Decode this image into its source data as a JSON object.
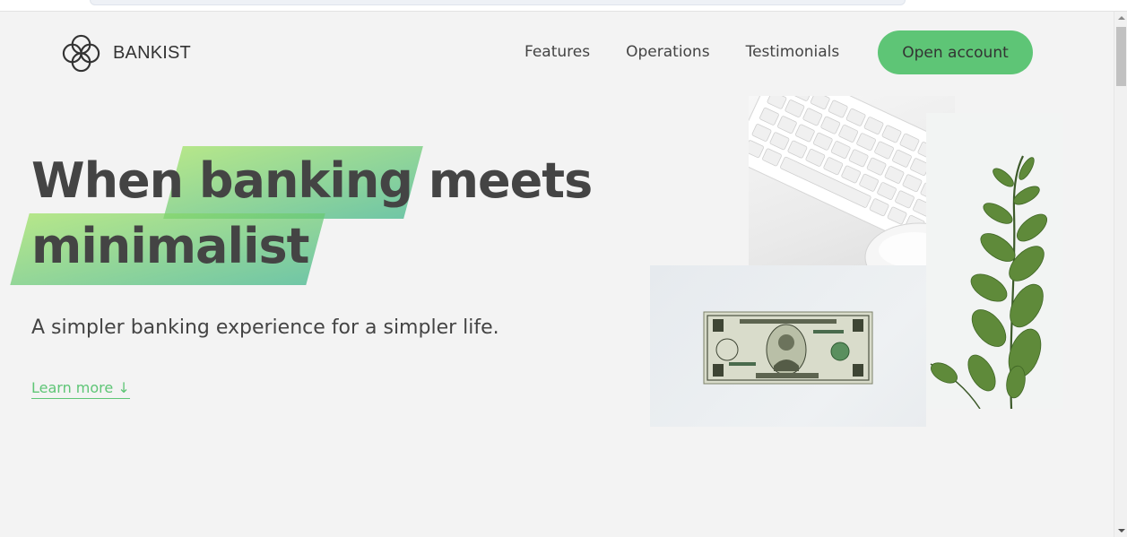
{
  "brand": {
    "logo_icon": "four-circles-logo-icon",
    "name": "BANKIST"
  },
  "nav": {
    "links": [
      {
        "label": "Features"
      },
      {
        "label": "Operations"
      },
      {
        "label": "Testimonials"
      }
    ],
    "cta_label": "Open account"
  },
  "hero": {
    "title_line1_a": "When ",
    "title_line1_highlight": "banking",
    "title_line1_b": " meets",
    "title_line2_highlight": "minimalist",
    "subtitle": "A simpler banking experience for a simpler life.",
    "learn_more": "Learn more ↓"
  },
  "images": {
    "keyboard": "keyboard-and-mouse-photo",
    "plant": "eucalyptus-plant-photo",
    "dollar": "one-dollar-bill-photo"
  },
  "colors": {
    "accent": "#5ec576",
    "gradient_start": "#9be15d",
    "gradient_end": "#39b385",
    "background": "#f3f3f3",
    "text": "#444444"
  }
}
